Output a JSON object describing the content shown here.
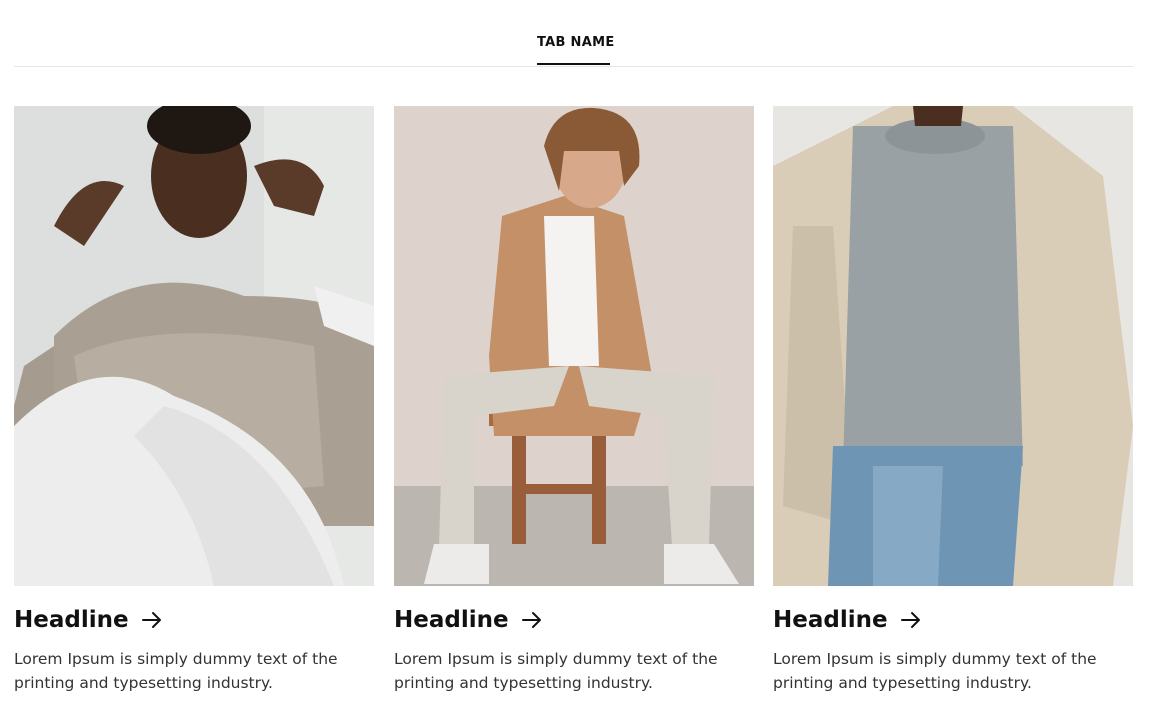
{
  "tabs": [
    {
      "label": "TAB NAME",
      "active": true
    }
  ],
  "cards": [
    {
      "headline": "Headline",
      "description": "Lorem Ipsum is simply dummy text of the printing and typesetting industry."
    },
    {
      "headline": "Headline",
      "description": "Lorem Ipsum is simply dummy text of the printing and typesetting industry."
    },
    {
      "headline": "Headline",
      "description": "Lorem Ipsum is simply dummy text of the printing and typesetting industry."
    }
  ],
  "icons": {
    "headline_arrow": "arrow-right-icon"
  },
  "colors": {
    "text": "#111111",
    "body_text": "#333333",
    "divider": "#e6e6e6"
  }
}
